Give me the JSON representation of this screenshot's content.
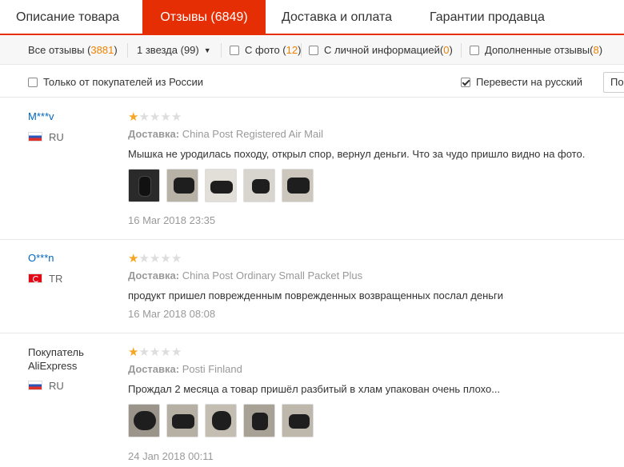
{
  "tabs": [
    {
      "label": "Описание товара",
      "active": false
    },
    {
      "label": "Отзывы (6849)",
      "active": true
    },
    {
      "label": "Доставка и оплата",
      "active": false
    },
    {
      "label": "Гарантии продавца",
      "active": false
    }
  ],
  "filters": {
    "all_reviews": {
      "label": "Все отзывы",
      "count": "3881"
    },
    "star_select": {
      "label": "1 звезда (99)"
    },
    "with_photo": {
      "label": "С фото",
      "count": "12",
      "checked": false
    },
    "personal_info": {
      "label": "С личной информацией",
      "count": "0",
      "checked": false
    },
    "additional": {
      "label": "Дополненные отзывы",
      "count": "8",
      "checked": false
    },
    "russia_only": {
      "label": "Только от покупателей из России",
      "checked": false
    },
    "translate": {
      "label": "Перевести на русский",
      "checked": true
    },
    "sort_label": "По"
  },
  "reviews": [
    {
      "user": "M***v",
      "country": "RU",
      "rating": 1,
      "shipping_label": "Доставка:",
      "shipping": "China Post Registered Air Mail",
      "text": "Мышка не уродилась походу, открыл спор, вернул деньги. Что за чудо пришло видно на фото.",
      "photo_count": 5,
      "date": "16 Mar 2018 23:35"
    },
    {
      "user": "O***n",
      "country": "TR",
      "rating": 1,
      "shipping_label": "Доставка:",
      "shipping": "China Post Ordinary Small Packet Plus",
      "text": "продукт пришел поврежденным поврежденных возвращенных послал деньги",
      "photo_count": 0,
      "date": "16 Mar 2018 08:08"
    },
    {
      "user": "Покупатель AliExpress",
      "country": "RU",
      "rating": 1,
      "shipping_label": "Доставка:",
      "shipping": "Posti Finland",
      "text": "Прождал 2 месяца а товар пришёл разбитый в хлам упакован очень плохо...",
      "photo_count": 5,
      "date": "24 Jan 2018 00:11"
    }
  ],
  "colors": {
    "accent": "#e62e04",
    "count": "#f08200",
    "link": "#0066c0",
    "star": "#f5a623"
  }
}
